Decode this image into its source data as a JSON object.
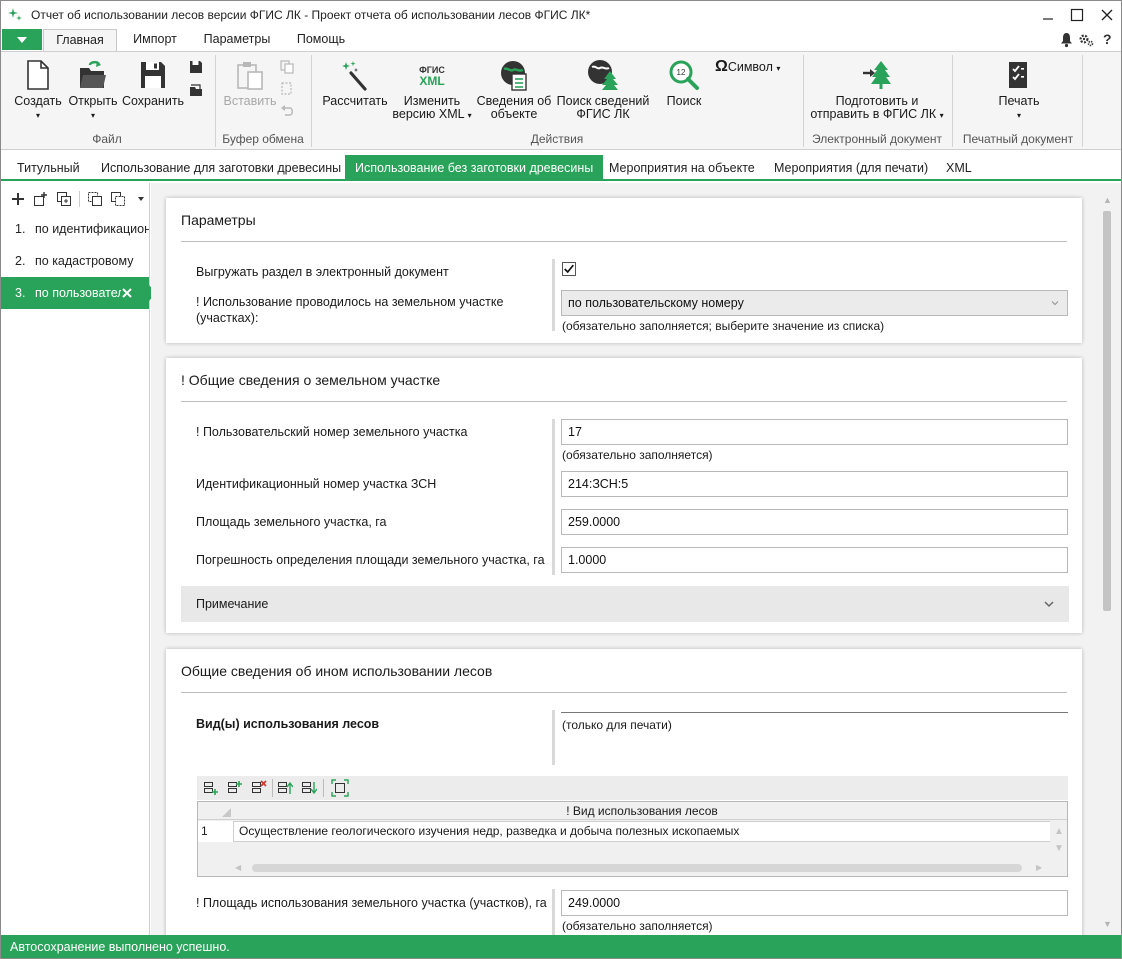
{
  "window": {
    "title": "Отчет об использовании лесов версии ФГИС ЛК - Проект отчета об использовании лесов ФГИС ЛК*"
  },
  "menu": {
    "tabs": [
      "Главная",
      "Импорт",
      "Параметры",
      "Помощь"
    ]
  },
  "ribbon": {
    "file": {
      "create": "Создать",
      "open": "Открыть",
      "save": "Сохранить",
      "group": "Файл"
    },
    "clipboard": {
      "paste": "Вставить",
      "group": "Буфер обмена"
    },
    "actions": {
      "calculate": "Рассчитать",
      "xml_icon_line1": "ФГИС",
      "xml_icon_line2": "XML",
      "change_xml_1": "Изменить",
      "change_xml_2": "версию XML",
      "object_info_1": "Сведения об",
      "object_info_2": "объекте",
      "search_fgis_1": "Поиск сведений",
      "search_fgis_2": "ФГИС ЛК",
      "search": "Поиск",
      "search_badge": "12",
      "symbol": "Символ",
      "group": "Действия"
    },
    "edoc": {
      "prepare_1": "Подготовить и",
      "prepare_2": "отправить в ФГИС ЛК",
      "group": "Электронный документ"
    },
    "print": {
      "print": "Печать",
      "group": "Печатный документ"
    }
  },
  "doc_tabs": [
    "Титульный",
    "Использование для заготовки древесины",
    "Использование без заготовки древесины",
    "Мероприятия на объекте",
    "Мероприятия (для печати)",
    "XML"
  ],
  "left_items": [
    {
      "num": "1.",
      "label": "по идентификационному"
    },
    {
      "num": "2.",
      "label": "по кадастровому"
    },
    {
      "num": "3.",
      "label": "по пользовательскому"
    }
  ],
  "params": {
    "title": "Параметры",
    "export_label": "Выгружать раздел в электронный документ",
    "export_checked": true,
    "usage_label_1": "! Использование проводилось на земельном участке",
    "usage_label_2": "(участках):",
    "usage_value": "по пользовательскому номеру",
    "usage_hint": "(обязательно заполняется; выберите значение из списка)"
  },
  "land": {
    "title": "! Общие сведения о земельном участке",
    "user_num_label": "! Пользовательский номер земельного участка",
    "user_num_value": "17",
    "user_num_hint": "(обязательно заполняется)",
    "zsn_label": "Идентификационный номер участка ЗСН",
    "zsn_value": "214:ЗСН:5",
    "area_label": "Площадь земельного участка, га",
    "area_value": "259.0000",
    "error_label": "Погрешность определения площади земельного участка, га",
    "error_value": "1.0000",
    "note_label": "Примечание"
  },
  "other": {
    "title": "Общие сведения об ином использовании лесов",
    "kinds_label": "Вид(ы) использования лесов",
    "print_only": "(только для печати)",
    "table_header": "! Вид использования лесов",
    "rows": [
      {
        "num": "1",
        "value": "Осуществление геологического изучения недр, разведка и добыча полезных ископаемых"
      }
    ],
    "area_label": "! Площадь использования земельного участка (участков), га",
    "area_value": "249.0000",
    "area_hint": "(обязательно заполняется)"
  },
  "status": "Автосохранение выполнено успешно.",
  "colors": {
    "accent": "#2aa35a"
  }
}
